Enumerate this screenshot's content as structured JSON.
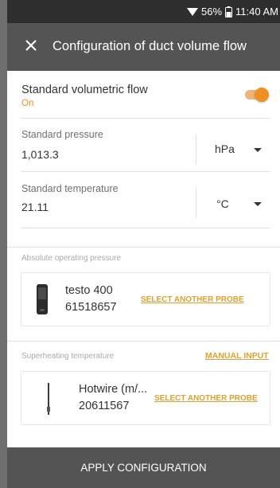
{
  "status_bar": {
    "battery": "56%",
    "time": "11:40 AM"
  },
  "app_bar": {
    "title": "Configuration of duct volume flow"
  },
  "standard_flow": {
    "label": "Standard volumetric flow",
    "state": "On",
    "enabled": true
  },
  "standard_pressure": {
    "label": "Standard pressure",
    "value": "1,013.3",
    "unit": "hPa"
  },
  "standard_temperature": {
    "label": "Standard temperature",
    "value": "21.11",
    "unit": "°C"
  },
  "absolute_pressure": {
    "section_label": "Absolute operating pressure",
    "probe_name": "testo 400",
    "probe_serial": "61518657",
    "select_label": "SELECT ANOTHER PROBE"
  },
  "superheating": {
    "section_label": "Superheating temperature",
    "manual_label": "MANUAL INPUT",
    "probe_name": "Hotwire (m/...",
    "probe_serial": "20611567",
    "select_label": "SELECT ANOTHER PROBE"
  },
  "bottom": {
    "apply_label": "APPLY CONFIGURATION"
  },
  "colors": {
    "accent": "#f08f22",
    "link": "#e2a02e",
    "header": "#545454",
    "statusbar": "#2e2e2e"
  }
}
